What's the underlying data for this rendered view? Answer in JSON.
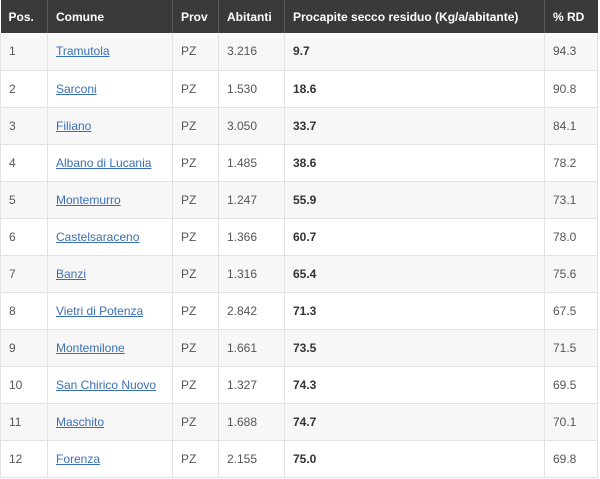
{
  "table": {
    "headers": [
      "Pos.",
      "Comune",
      "Prov",
      "Abitanti",
      "Procapite secco residuo (Kg/a/abitante)",
      "% RD"
    ],
    "rows": [
      {
        "pos": "1",
        "comune": "Tramutola",
        "prov": "PZ",
        "abitanti": "3.216",
        "procapite": "9.7",
        "rd": "94.3"
      },
      {
        "pos": "2",
        "comune": "Sarconi",
        "prov": "PZ",
        "abitanti": "1.530",
        "procapite": "18.6",
        "rd": "90.8"
      },
      {
        "pos": "3",
        "comune": "Filiano",
        "prov": "PZ",
        "abitanti": "3.050",
        "procapite": "33.7",
        "rd": "84.1"
      },
      {
        "pos": "4",
        "comune": "Albano di Lucania",
        "prov": "PZ",
        "abitanti": "1.485",
        "procapite": "38.6",
        "rd": "78.2"
      },
      {
        "pos": "5",
        "comune": "Montemurro",
        "prov": "PZ",
        "abitanti": "1.247",
        "procapite": "55.9",
        "rd": "73.1"
      },
      {
        "pos": "6",
        "comune": "Castelsaraceno",
        "prov": "PZ",
        "abitanti": "1.366",
        "procapite": "60.7",
        "rd": "78.0"
      },
      {
        "pos": "7",
        "comune": "Banzi",
        "prov": "PZ",
        "abitanti": "1.316",
        "procapite": "65.4",
        "rd": "75.6"
      },
      {
        "pos": "8",
        "comune": "Vietri di Potenza",
        "prov": "PZ",
        "abitanti": "2.842",
        "procapite": "71.3",
        "rd": "67.5"
      },
      {
        "pos": "9",
        "comune": "Montemilone",
        "prov": "PZ",
        "abitanti": "1.661",
        "procapite": "73.5",
        "rd": "71.5"
      },
      {
        "pos": "10",
        "comune": "San Chirico Nuovo",
        "prov": "PZ",
        "abitanti": "1.327",
        "procapite": "74.3",
        "rd": "69.5"
      },
      {
        "pos": "11",
        "comune": "Maschito",
        "prov": "PZ",
        "abitanti": "1.688",
        "procapite": "74.7",
        "rd": "70.1"
      },
      {
        "pos": "12",
        "comune": "Forenza",
        "prov": "PZ",
        "abitanti": "2.155",
        "procapite": "75.0",
        "rd": "69.8"
      }
    ]
  }
}
